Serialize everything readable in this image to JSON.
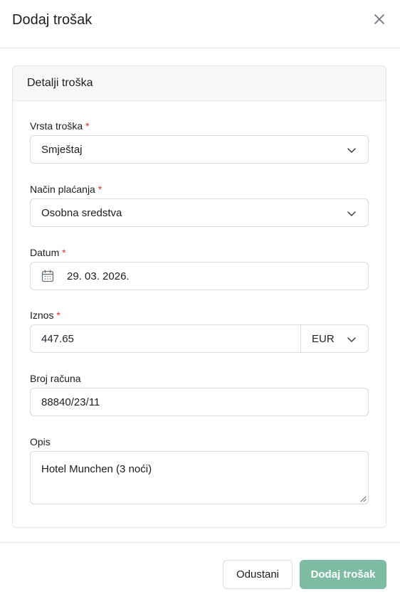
{
  "modal": {
    "title": "Dodaj trošak",
    "close_icon": "close-icon"
  },
  "card": {
    "title": "Detalji troška"
  },
  "form": {
    "expense_type": {
      "label": "Vrsta troška",
      "required_mark": "*",
      "value": "Smještaj",
      "icon": "chevron-down-icon"
    },
    "payment_method": {
      "label": "Način plaćanja",
      "required_mark": "*",
      "value": "Osobna sredstva",
      "icon": "chevron-down-icon"
    },
    "date": {
      "label": "Datum",
      "required_mark": "*",
      "value": "29. 03. 2026.",
      "icon": "calendar-icon"
    },
    "amount": {
      "label": "Iznos",
      "required_mark": "*",
      "value": "447.65",
      "currency": "EUR",
      "icon": "chevron-down-icon"
    },
    "invoice_number": {
      "label": "Broj računa",
      "value": "88840/23/11"
    },
    "description": {
      "label": "Opis",
      "value": "Hotel Munchen (3 noći)"
    }
  },
  "footer": {
    "cancel_label": "Odustani",
    "submit_label": "Dodaj trošak"
  },
  "colors": {
    "accent": "#7dbba3",
    "required": "#d93025",
    "border": "#d8dbe0"
  }
}
